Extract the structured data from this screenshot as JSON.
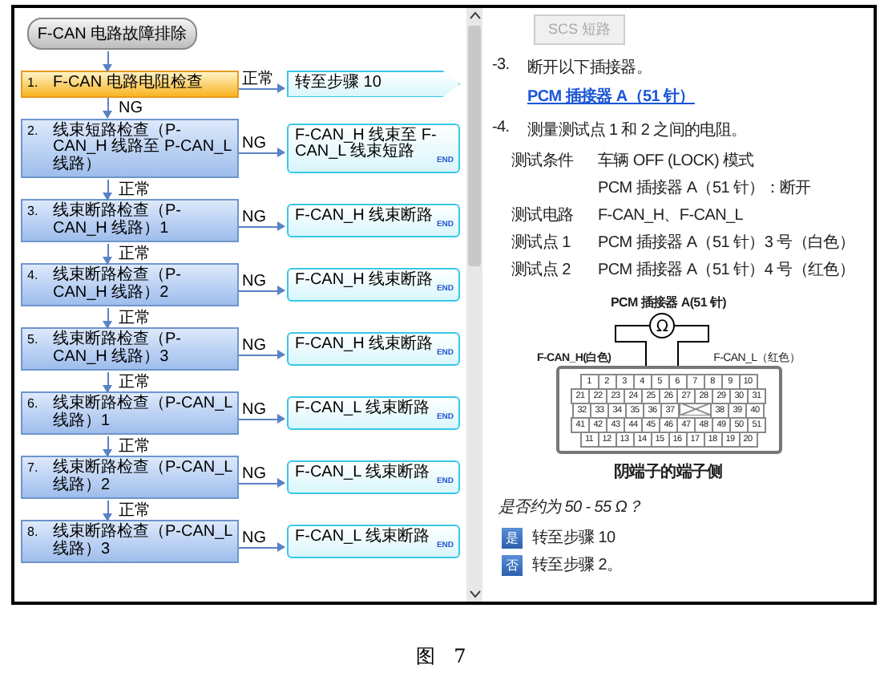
{
  "flowchart": {
    "title": "F-CAN 电路故障排除",
    "steps": [
      {
        "number": "1.",
        "text": "F-CAN 电路电阻检查",
        "kind": "current",
        "branch_label": "正常",
        "result": {
          "text": "转至步骤 10",
          "kind": "goto"
        },
        "next_label": "NG"
      },
      {
        "number": "2.",
        "text": "线束短路检查（P-CAN_H 线路至 P-CAN_L 线路）",
        "kind": "normal",
        "branch_label": "NG",
        "result": {
          "text": "F-CAN_H 线束至 F-CAN_L 线束短路",
          "kind": "end",
          "end_label": "END"
        },
        "next_label": "正常"
      },
      {
        "number": "3.",
        "text": "线束断路检查（P-CAN_H 线路）1",
        "kind": "normal",
        "branch_label": "NG",
        "result": {
          "text": "F-CAN_H 线束断路",
          "kind": "end",
          "end_label": "END"
        },
        "next_label": "正常"
      },
      {
        "number": "4.",
        "text": "线束断路检查（P-CAN_H 线路）2",
        "kind": "normal",
        "branch_label": "NG",
        "result": {
          "text": "F-CAN_H 线束断路",
          "kind": "end",
          "end_label": "END"
        },
        "next_label": "正常"
      },
      {
        "number": "5.",
        "text": "线束断路检查（P-CAN_H 线路）3",
        "kind": "normal",
        "branch_label": "NG",
        "result": {
          "text": "F-CAN_H 线束断路",
          "kind": "end",
          "end_label": "END"
        },
        "next_label": "正常"
      },
      {
        "number": "6.",
        "text": "线束断路检查（P-CAN_L 线路）1",
        "kind": "normal",
        "branch_label": "NG",
        "result": {
          "text": "F-CAN_L 线束断路",
          "kind": "end",
          "end_label": "END"
        },
        "next_label": "正常"
      },
      {
        "number": "7.",
        "text": "线束断路检查（P-CAN_L 线路）2",
        "kind": "normal",
        "branch_label": "NG",
        "result": {
          "text": "F-CAN_L 线束断路",
          "kind": "end",
          "end_label": "END"
        },
        "next_label": "正常"
      },
      {
        "number": "8.",
        "text": "线束断路检查（P-CAN_L 线路）3",
        "kind": "normal",
        "branch_label": "NG",
        "result": {
          "text": "F-CAN_L 线束断路",
          "kind": "end",
          "end_label": "END"
        }
      }
    ]
  },
  "procedure": {
    "top_button": {
      "label": "SCS 短路",
      "disabled": true
    },
    "instructions": [
      {
        "number": "-3.",
        "text": "断开以下插接器。",
        "link": "PCM 插接器 A（51 针）"
      },
      {
        "number": "-4.",
        "text": "测量测试点 1 和 2 之间的电阻。"
      }
    ],
    "conditions": [
      {
        "label": "测试条件",
        "value": "车辆 OFF (LOCK) 模式"
      },
      {
        "value": "PCM 插接器 A（51 针）：断开"
      },
      {
        "label": "测试电路",
        "value": "F-CAN_H、F-CAN_L"
      },
      {
        "label": "测试点 1",
        "value": "PCM 插接器 A（51 针）3 号（白色）"
      },
      {
        "label": "测试点 2",
        "value": "PCM 插接器 A（51 针）4 号（红色）"
      }
    ],
    "connector": {
      "title": "PCM 插接器 A(51 针)",
      "meter": "Ω",
      "wire_1": "F-CAN_H(白色)",
      "wire_2": "F-CAN_L（红色）",
      "caption": "阴端子的端子侧",
      "pin_rows": [
        [
          "1",
          "2",
          "3",
          "4",
          "5",
          "6",
          "7",
          "8",
          "9",
          "10"
        ],
        [
          "21",
          "22",
          "23",
          "24",
          "25",
          "26",
          "27",
          "28",
          "29",
          "30",
          "31"
        ],
        [
          "32",
          "33",
          "34",
          "35",
          "36",
          "37",
          "38",
          "39",
          "40"
        ],
        [
          "41",
          "42",
          "43",
          "44",
          "45",
          "46",
          "47",
          "48",
          "49",
          "50",
          "51"
        ],
        [
          "11",
          "12",
          "13",
          "14",
          "15",
          "16",
          "17",
          "18",
          "19",
          "20"
        ]
      ]
    },
    "question": "是否约为 50 - 55 Ω？",
    "answers": [
      {
        "key": "是",
        "text": "转至步骤 10"
      },
      {
        "key": "否",
        "text": "转至步骤 2。"
      }
    ]
  },
  "caption": "图 7"
}
